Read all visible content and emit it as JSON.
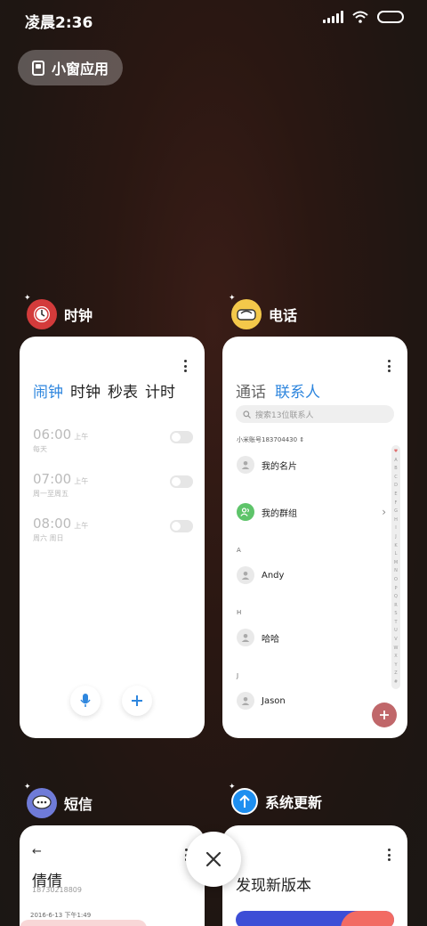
{
  "status": {
    "time": "凌晨2:36",
    "icons": [
      "signal-icon",
      "wifi-icon",
      "battery-icon"
    ]
  },
  "small_window": {
    "label": "小窗应用",
    "icon": "small-window-icon"
  },
  "clock_app": {
    "name": "时钟",
    "tabs": [
      "闹钟",
      "时钟",
      "秒表",
      "计时"
    ],
    "active_tab": "闹钟",
    "alarms": [
      {
        "time": "06:00",
        "ampm": "上午",
        "repeat": "每天"
      },
      {
        "time": "07:00",
        "ampm": "上午",
        "repeat": "周一至周五"
      },
      {
        "time": "08:00",
        "ampm": "上午",
        "repeat": "周六 周日"
      }
    ]
  },
  "phone_app": {
    "name": "电话",
    "tabs": [
      "通话",
      "联系人"
    ],
    "active_tab": "联系人",
    "search_placeholder": "搜索13位联系人",
    "account": "小米账号183704430",
    "my_card": "我的名片",
    "my_group": "我的群组",
    "sections": [
      {
        "letter": "A",
        "name": "Andy"
      },
      {
        "letter": "H",
        "name": "哈哈"
      },
      {
        "letter": "J",
        "name": "Jason"
      }
    ],
    "index_letters": [
      "♥",
      "A",
      "B",
      "C",
      "D",
      "E",
      "F",
      "G",
      "H",
      "I",
      "J",
      "K",
      "L",
      "M",
      "N",
      "O",
      "P",
      "Q",
      "R",
      "S",
      "T",
      "U",
      "V",
      "W",
      "X",
      "Y",
      "Z",
      "#"
    ]
  },
  "sms_app": {
    "name": "短信",
    "contact_name": "倩倩",
    "contact_number": "18730218809",
    "date": "2016-6-13 下午1:49"
  },
  "update_app": {
    "name": "系统更新",
    "headline": "发现新版本"
  },
  "colors": {
    "accent": "#2e86de",
    "fab": "#c0676a",
    "group_green": "#5ec46a"
  }
}
